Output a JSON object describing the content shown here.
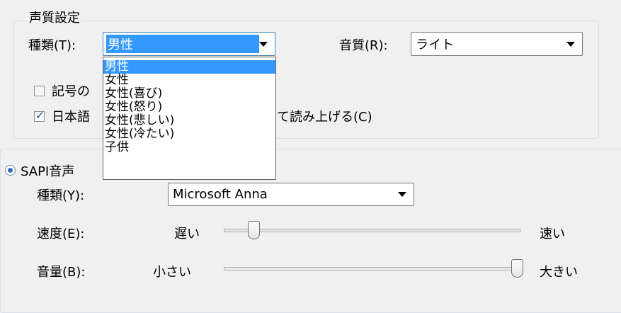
{
  "voice_settings": {
    "legend": "声質設定",
    "type_label": "種類(T):",
    "type_value": "男性",
    "quality_label": "音質(R):",
    "quality_value": "ライト",
    "dropdown_options": [
      "男性",
      "女性",
      "女性(喜び)",
      "女性(怒り)",
      "女性(悲しい)",
      "女性(冷たい)",
      "子供"
    ],
    "dropdown_selected_index": 0,
    "checkbox_symbols": {
      "label": "記号の",
      "checked": false
    },
    "checkbox_japanese": {
      "label_start": "日本語",
      "label_end": "て読み上げる(C)",
      "checked": true
    }
  },
  "sapi": {
    "radio_label": "SAPI音声",
    "radio_checked": true,
    "type_label": "種類(Y):",
    "type_value": "Microsoft Anna",
    "speed_label": "速度(E):",
    "speed_min": "遅い",
    "speed_max": "速い",
    "speed_value_fraction": 0.07,
    "volume_label": "音量(B):",
    "volume_min": "小さい",
    "volume_max": "大きい",
    "volume_value_fraction": 1.0
  },
  "colors": {
    "selection": "#3399ff",
    "window_bg": "#f0f0f0"
  }
}
